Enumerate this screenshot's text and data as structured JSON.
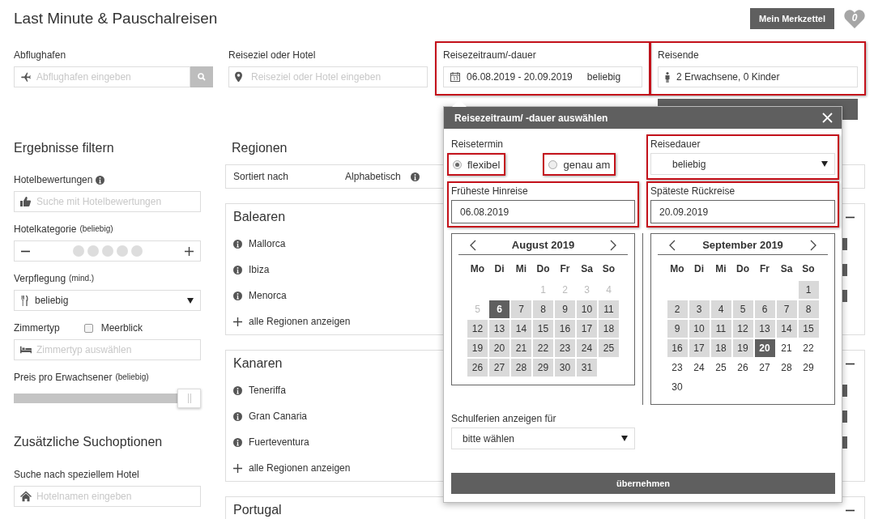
{
  "header": {
    "title": "Last Minute & Pauschalreisen",
    "watchlist_button": "Mein Merkzettel",
    "watchlist_count": "0"
  },
  "search": {
    "fields": [
      {
        "kind": "airport",
        "label": "Abflughafen",
        "placeholder": "Abflughafen eingeben",
        "highlighted": false
      },
      {
        "kind": "destination",
        "label": "Reiseziel oder Hotel",
        "placeholder": "Reiseziel oder Hotel eingeben",
        "highlighted": false
      },
      {
        "kind": "dates",
        "label": "Reisezeitraum/-dauer",
        "value": "06.08.2019 - 20.09.2019",
        "duration": "beliebig",
        "highlighted": true
      },
      {
        "kind": "travellers",
        "label": "Reisende",
        "value": "2 Erwachsene, 0 Kinder",
        "highlighted": true
      }
    ]
  },
  "filters": {
    "title": "Ergebnisse filtern",
    "rating": {
      "label": "Hotelbewertungen",
      "placeholder": "Suche mit Hotelbewertungen"
    },
    "category": {
      "label": "Hotelkategorie",
      "hint": "(beliebig)",
      "stars": 0
    },
    "board": {
      "label": "Verpflegung",
      "hint": "(mind.)",
      "value": "beliebig"
    },
    "room": {
      "label": "Zimmertyp",
      "sea_view": {
        "label": "Meerblick",
        "checked": false
      },
      "placeholder": "Zimmertyp auswählen"
    },
    "price": {
      "label": "Preis pro Erwachsener",
      "hint": "(beliebig)",
      "level": 1
    }
  },
  "more_options": {
    "title": "Zusätzliche Suchoptionen",
    "hotel": {
      "label": "Suche nach speziellem Hotel",
      "placeholder": "Hotelnamen eingeben"
    }
  },
  "regions": {
    "title": "Regionen",
    "sort_label": "Sortiert nach",
    "sort_value": "Alphabetisch",
    "groups": [
      {
        "name": "Balearen",
        "expanded": true,
        "items": [
          "Mallorca",
          "Ibiza",
          "Menorca"
        ],
        "show_all": "alle Regionen anzeigen"
      },
      {
        "name": "Kanaren",
        "expanded": true,
        "items": [
          "Teneriffa",
          "Gran Canaria",
          "Fuerteventura"
        ],
        "show_all": "alle Regionen anzeigen"
      },
      {
        "name": "Portugal",
        "expanded": true
      }
    ]
  },
  "popup": {
    "title": "Reisezeitraum/ -dauer auswählen",
    "date_mode": {
      "label": "Reisetermin",
      "options": [
        {
          "label": "flexibel",
          "selected": true,
          "highlighted": true
        },
        {
          "label": "genau am",
          "selected": false,
          "highlighted": true
        }
      ]
    },
    "duration": {
      "label": "Reisedauer",
      "value": "beliebig",
      "highlighted": true
    },
    "earliest": {
      "label": "Früheste Hinreise",
      "value": "06.08.2019",
      "highlighted": true
    },
    "latest": {
      "label": "Späteste Rückreise",
      "value": "20.09.2019",
      "highlighted": true
    },
    "calendars": [
      {
        "month": "August 2019",
        "weekdays": [
          "Mo",
          "Di",
          "Mi",
          "Do",
          "Fr",
          "Sa",
          "So"
        ],
        "weeks": [
          [
            {
              "day": "1",
              "kind": "muted",
              "selected": false
            },
            {
              "day": "2",
              "kind": "muted",
              "selected": false
            },
            {
              "day": "3",
              "kind": "muted",
              "selected": false
            },
            {
              "day": "4",
              "kind": "muted",
              "selected": false
            }
          ],
          [
            {
              "day": "5",
              "kind": "muted",
              "selected": false
            },
            {
              "day": "6",
              "kind": "range",
              "selected": true
            },
            {
              "day": "7",
              "kind": "range",
              "selected": false
            },
            {
              "day": "8",
              "kind": "range",
              "selected": false
            },
            {
              "day": "9",
              "kind": "range",
              "selected": false
            },
            {
              "day": "10",
              "kind": "range",
              "selected": false
            },
            {
              "day": "11",
              "kind": "range",
              "selected": false
            }
          ],
          [
            {
              "day": "12",
              "kind": "range",
              "selected": false
            },
            {
              "day": "13",
              "kind": "range",
              "selected": false
            },
            {
              "day": "14",
              "kind": "range",
              "selected": false
            },
            {
              "day": "15",
              "kind": "range",
              "selected": false
            },
            {
              "day": "16",
              "kind": "range",
              "selected": false
            },
            {
              "day": "17",
              "kind": "range",
              "selected": false
            },
            {
              "day": "18",
              "kind": "range",
              "selected": false
            }
          ],
          [
            {
              "day": "19",
              "kind": "range",
              "selected": false
            },
            {
              "day": "20",
              "kind": "range",
              "selected": false
            },
            {
              "day": "21",
              "kind": "range",
              "selected": false
            },
            {
              "day": "22",
              "kind": "range",
              "selected": false
            },
            {
              "day": "23",
              "kind": "range",
              "selected": false
            },
            {
              "day": "24",
              "kind": "range",
              "selected": false
            },
            {
              "day": "25",
              "kind": "range",
              "selected": false
            }
          ],
          [
            {
              "day": "26",
              "kind": "range",
              "selected": false
            },
            {
              "day": "27",
              "kind": "range",
              "selected": false
            },
            {
              "day": "28",
              "kind": "range",
              "selected": false
            },
            {
              "day": "29",
              "kind": "range",
              "selected": false
            },
            {
              "day": "30",
              "kind": "range",
              "selected": false
            },
            {
              "day": "31",
              "kind": "range",
              "selected": false
            }
          ]
        ]
      },
      {
        "month": "September 2019",
        "weekdays": [
          "Mo",
          "Di",
          "Mi",
          "Do",
          "Fr",
          "Sa",
          "So"
        ],
        "weeks": [
          [
            {
              "day": "1",
              "kind": "range",
              "selected": false
            }
          ],
          [
            {
              "day": "2",
              "kind": "range",
              "selected": false
            },
            {
              "day": "3",
              "kind": "range",
              "selected": false
            },
            {
              "day": "4",
              "kind": "range",
              "selected": false
            },
            {
              "day": "5",
              "kind": "range",
              "selected": false
            },
            {
              "day": "6",
              "kind": "range",
              "selected": false
            },
            {
              "day": "7",
              "kind": "range",
              "selected": false
            },
            {
              "day": "8",
              "kind": "range",
              "selected": false
            }
          ],
          [
            {
              "day": "9",
              "kind": "range",
              "selected": false
            },
            {
              "day": "10",
              "kind": "range",
              "selected": false
            },
            {
              "day": "11",
              "kind": "range",
              "selected": false
            },
            {
              "day": "12",
              "kind": "range",
              "selected": false
            },
            {
              "day": "13",
              "kind": "range",
              "selected": false
            },
            {
              "day": "14",
              "kind": "range",
              "selected": false
            },
            {
              "day": "15",
              "kind": "range",
              "selected": false
            }
          ],
          [
            {
              "day": "16",
              "kind": "range",
              "selected": false
            },
            {
              "day": "17",
              "kind": "range",
              "selected": false
            },
            {
              "day": "18",
              "kind": "range",
              "selected": false
            },
            {
              "day": "19",
              "kind": "range",
              "selected": false
            },
            {
              "day": "20",
              "kind": "range",
              "selected": true
            },
            {
              "day": "21",
              "kind": "plain",
              "selected": false
            },
            {
              "day": "22",
              "kind": "plain",
              "selected": false
            }
          ],
          [
            {
              "day": "23",
              "kind": "plain",
              "selected": false
            },
            {
              "day": "24",
              "kind": "plain",
              "selected": false
            },
            {
              "day": "25",
              "kind": "plain",
              "selected": false
            },
            {
              "day": "26",
              "kind": "plain",
              "selected": false
            },
            {
              "day": "27",
              "kind": "plain",
              "selected": false
            },
            {
              "day": "28",
              "kind": "plain",
              "selected": false
            },
            {
              "day": "29",
              "kind": "plain",
              "selected": false
            }
          ],
          [
            {
              "day": "30",
              "kind": "plain",
              "selected": false
            }
          ]
        ]
      }
    ],
    "holidays": {
      "label": "Schulferien anzeigen für",
      "value": "bitte wählen"
    },
    "apply_button": "übernehmen"
  }
}
